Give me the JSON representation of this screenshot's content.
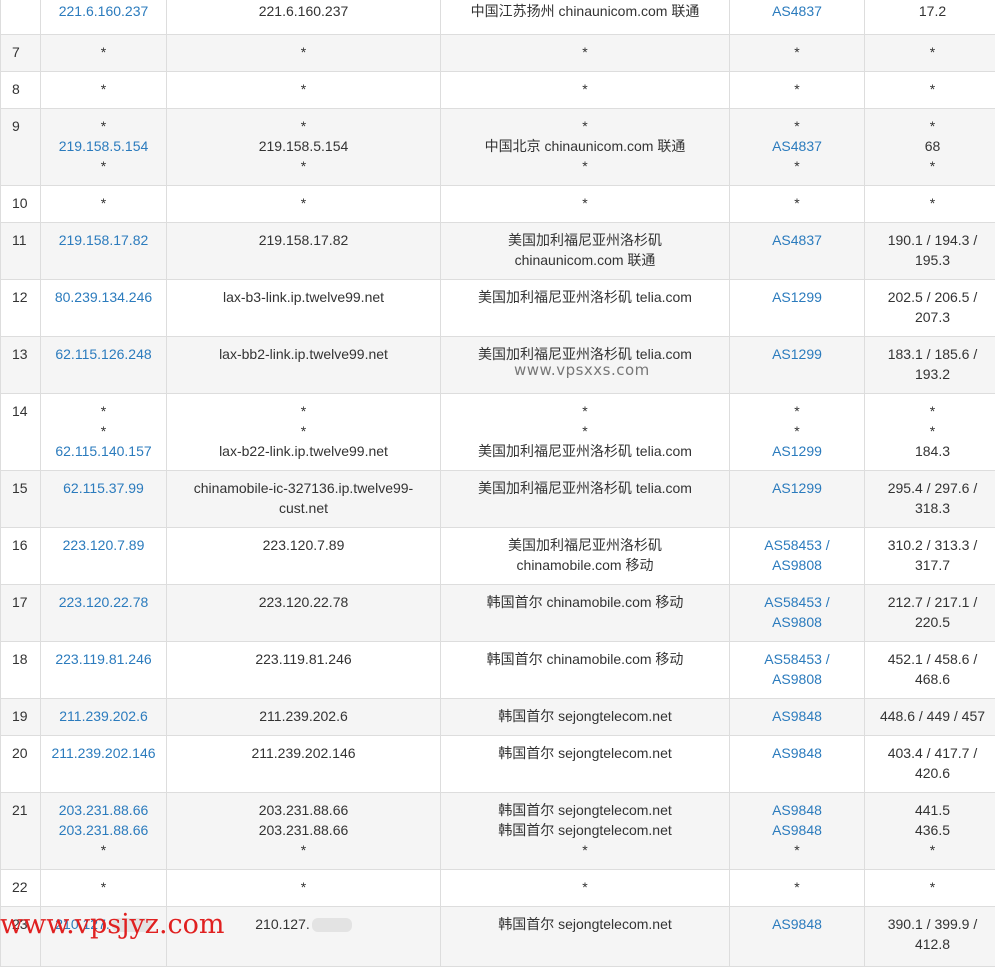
{
  "rows": [
    {
      "hop": "",
      "ip": [
        "221.6.160.237"
      ],
      "host": [
        "221.6.160.237"
      ],
      "loc": [
        "中国江苏扬州 chinaunicom.com 联通"
      ],
      "asn": [
        "AS4837"
      ],
      "rtt": [
        "17.2"
      ]
    },
    {
      "hop": "7",
      "ip": [
        "*"
      ],
      "host": [
        "*"
      ],
      "loc": [
        "*"
      ],
      "asn": [
        "*"
      ],
      "rtt": [
        "*"
      ]
    },
    {
      "hop": "8",
      "ip": [
        "*"
      ],
      "host": [
        "*"
      ],
      "loc": [
        "*"
      ],
      "asn": [
        "*"
      ],
      "rtt": [
        "*"
      ]
    },
    {
      "hop": "9",
      "ip": [
        "*",
        "219.158.5.154",
        "*"
      ],
      "host": [
        "*",
        "219.158.5.154",
        "*"
      ],
      "loc": [
        "*",
        "中国北京 chinaunicom.com 联通",
        "*"
      ],
      "asn": [
        "*",
        "AS4837",
        "*"
      ],
      "rtt": [
        "*",
        "68",
        "*"
      ]
    },
    {
      "hop": "10",
      "ip": [
        "*"
      ],
      "host": [
        "*"
      ],
      "loc": [
        "*"
      ],
      "asn": [
        "*"
      ],
      "rtt": [
        "*"
      ]
    },
    {
      "hop": "11",
      "ip": [
        "219.158.17.82"
      ],
      "host": [
        "219.158.17.82"
      ],
      "loc": [
        "美国加利福尼亚州洛杉矶",
        "chinaunicom.com 联通"
      ],
      "asn": [
        "AS4837"
      ],
      "rtt": [
        "190.1 / 194.3 /",
        "195.3"
      ]
    },
    {
      "hop": "12",
      "ip": [
        "80.239.134.246"
      ],
      "host": [
        "lax-b3-link.ip.twelve99.net"
      ],
      "loc": [
        "美国加利福尼亚州洛杉矶 telia.com"
      ],
      "asn": [
        "AS1299"
      ],
      "rtt": [
        "202.5 / 206.5 /",
        "207.3"
      ]
    },
    {
      "hop": "13",
      "ip": [
        "62.115.126.248"
      ],
      "host": [
        "lax-bb2-link.ip.twelve99.net"
      ],
      "loc": [
        "美国加利福尼亚州洛杉矶 telia.com"
      ],
      "asn": [
        "AS1299"
      ],
      "rtt": [
        "183.1 / 185.6 /",
        "193.2"
      ]
    },
    {
      "hop": "14",
      "ip": [
        "*",
        "*",
        "62.115.140.157"
      ],
      "host": [
        "*",
        "*",
        "lax-b22-link.ip.twelve99.net"
      ],
      "loc": [
        "*",
        "*",
        "美国加利福尼亚州洛杉矶 telia.com"
      ],
      "asn": [
        "*",
        "*",
        "AS1299"
      ],
      "rtt": [
        "*",
        "*",
        "184.3"
      ]
    },
    {
      "hop": "15",
      "ip": [
        "62.115.37.99"
      ],
      "host": [
        "chinamobile-ic-327136.ip.twelve99-",
        "cust.net"
      ],
      "loc": [
        "美国加利福尼亚州洛杉矶 telia.com"
      ],
      "asn": [
        "AS1299"
      ],
      "rtt": [
        "295.4 / 297.6 /",
        "318.3"
      ]
    },
    {
      "hop": "16",
      "ip": [
        "223.120.7.89"
      ],
      "host": [
        "223.120.7.89"
      ],
      "loc": [
        "美国加利福尼亚州洛杉矶",
        "chinamobile.com 移动"
      ],
      "asn": [
        "AS58453 /",
        "AS9808"
      ],
      "rtt": [
        "310.2 / 313.3 /",
        "317.7"
      ]
    },
    {
      "hop": "17",
      "ip": [
        "223.120.22.78"
      ],
      "host": [
        "223.120.22.78"
      ],
      "loc": [
        "韩国首尔 chinamobile.com 移动"
      ],
      "asn": [
        "AS58453 /",
        "AS9808"
      ],
      "rtt": [
        "212.7 / 217.1 /",
        "220.5"
      ]
    },
    {
      "hop": "18",
      "ip": [
        "223.119.81.246"
      ],
      "host": [
        "223.119.81.246"
      ],
      "loc": [
        "韩国首尔 chinamobile.com 移动"
      ],
      "asn": [
        "AS58453 /",
        "AS9808"
      ],
      "rtt": [
        "452.1 / 458.6 /",
        "468.6"
      ]
    },
    {
      "hop": "19",
      "ip": [
        "211.239.202.6"
      ],
      "host": [
        "211.239.202.6"
      ],
      "loc": [
        "韩国首尔 sejongtelecom.net"
      ],
      "asn": [
        "AS9848"
      ],
      "rtt": [
        "448.6 / 449 / 457"
      ]
    },
    {
      "hop": "20",
      "ip": [
        "211.239.202.146"
      ],
      "host": [
        "211.239.202.146"
      ],
      "loc": [
        "韩国首尔 sejongtelecom.net"
      ],
      "asn": [
        "AS9848"
      ],
      "rtt": [
        "403.4 / 417.7 /",
        "420.6"
      ]
    },
    {
      "hop": "21",
      "ip": [
        "203.231.88.66",
        "203.231.88.66",
        "*"
      ],
      "host": [
        "203.231.88.66",
        "203.231.88.66",
        "*"
      ],
      "loc": [
        "韩国首尔 sejongtelecom.net",
        "韩国首尔 sejongtelecom.net",
        "*"
      ],
      "asn": [
        "AS9848",
        "AS9848",
        "*"
      ],
      "rtt": [
        "441.5",
        "436.5",
        "*"
      ]
    },
    {
      "hop": "22",
      "ip": [
        "*"
      ],
      "host": [
        "*"
      ],
      "loc": [
        "*"
      ],
      "asn": [
        "*"
      ],
      "rtt": [
        "*"
      ]
    },
    {
      "hop": "23",
      "ip": [
        "210.127."
      ],
      "host": [
        "210.127."
      ],
      "loc": [
        "韩国首尔 sejongtelecom.net"
      ],
      "asn": [
        "AS9848"
      ],
      "rtt": [
        "390.1 / 399.9 /",
        "412.8"
      ]
    }
  ],
  "watermark_center": "www.vpsxxs.com",
  "watermark_corner": "www.vpsjyz.com",
  "colors": {
    "link": "#2b7bbd",
    "stripe": "#f5f5f5",
    "border": "#ddd",
    "watermark_corner": "#e02020"
  }
}
